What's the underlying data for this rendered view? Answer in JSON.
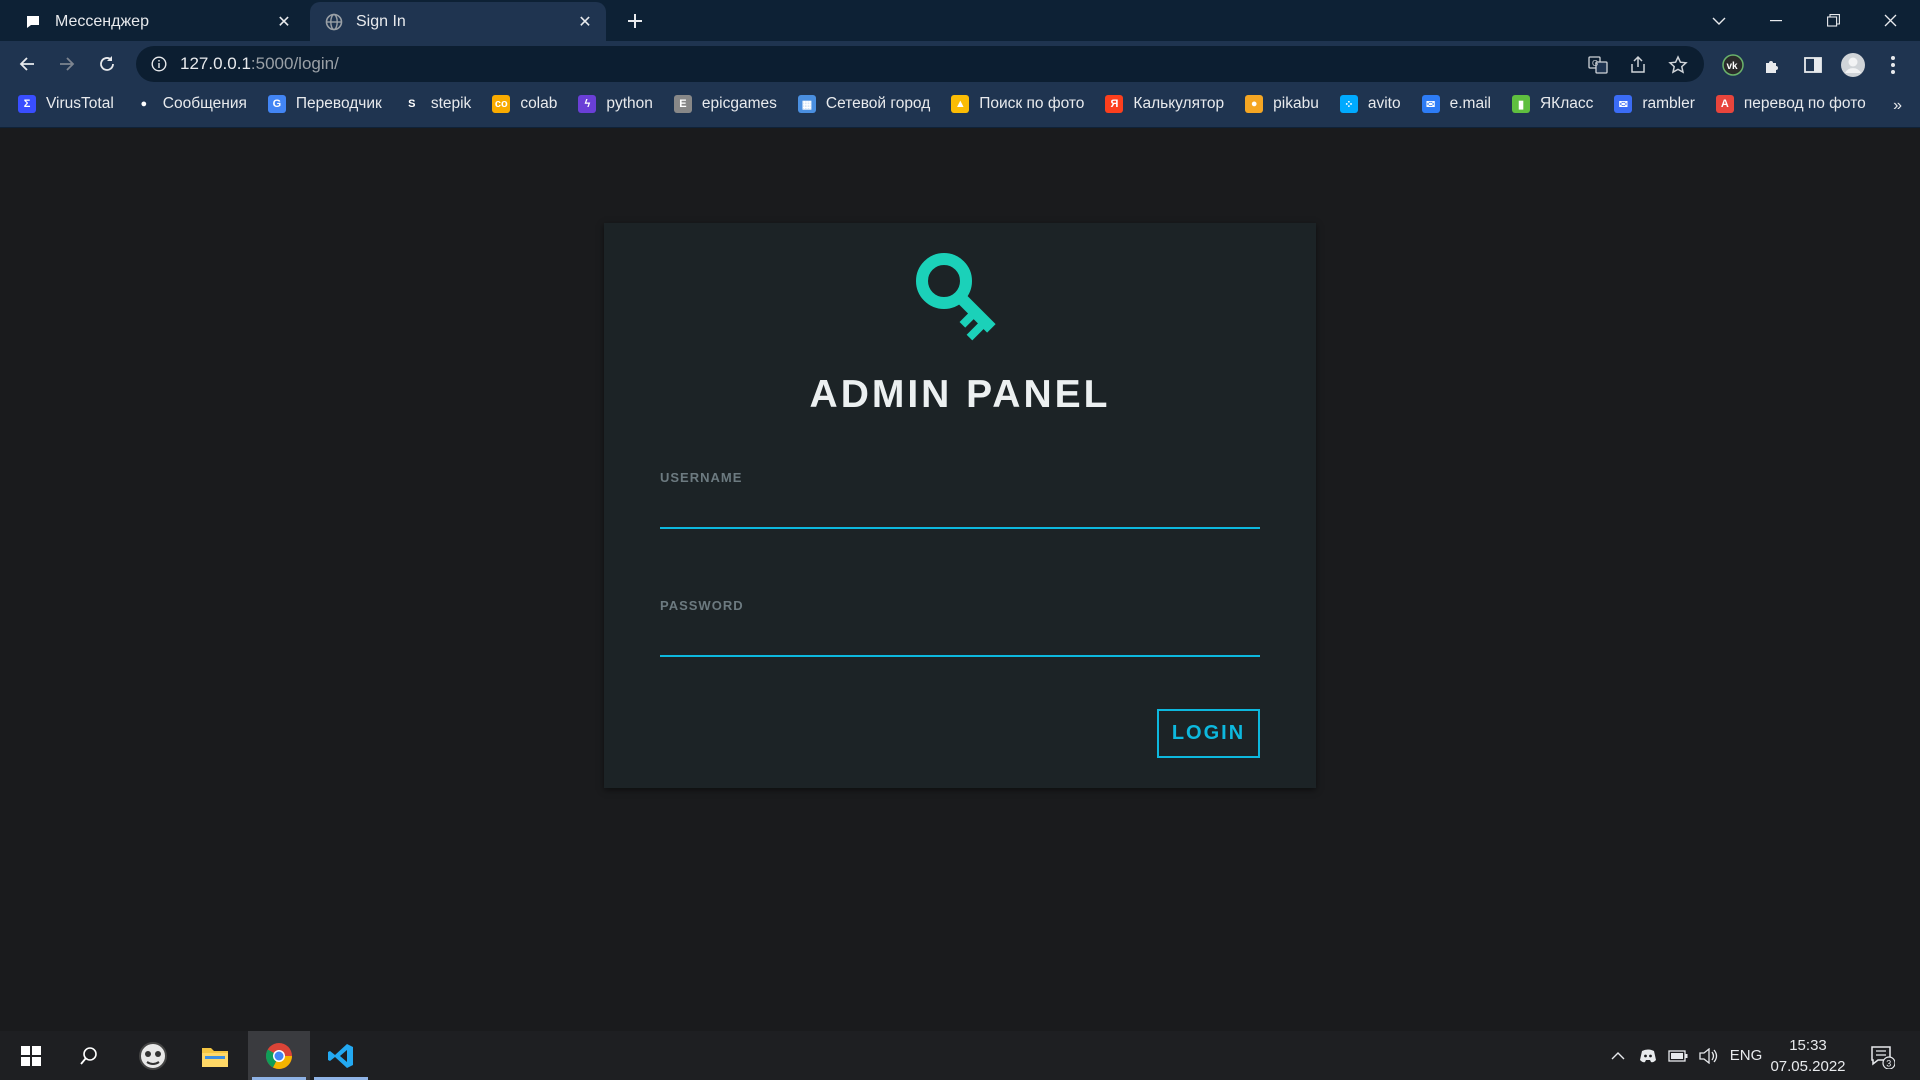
{
  "browser": {
    "tabs": [
      {
        "title": "Мессенджер",
        "active": false,
        "icon": "chat-bubble-icon"
      },
      {
        "title": "Sign In",
        "active": true,
        "icon": "globe-icon"
      }
    ],
    "url_host": "127.0.0.1",
    "url_rest": ":5000/login/",
    "bookmarks": [
      {
        "label": "VirusTotal",
        "icon": "virustotal-icon",
        "color": "#394eff"
      },
      {
        "label": "Сообщения",
        "icon": "chat-bubble-icon",
        "color": "#ffffff"
      },
      {
        "label": "Переводчик",
        "icon": "translate-icon",
        "color": "#4285f4"
      },
      {
        "label": "stepik",
        "icon": "stepik-icon",
        "color": "#ffffff"
      },
      {
        "label": "colab",
        "icon": "colab-icon",
        "color": "#f9ab00"
      },
      {
        "label": "python",
        "icon": "python-icon",
        "color": "#6a3fd6"
      },
      {
        "label": "epicgames",
        "icon": "epicgames-icon",
        "color": "#888888"
      },
      {
        "label": "Сетевой город",
        "icon": "city-icon",
        "color": "#4a8fe0"
      },
      {
        "label": "Поиск по фото",
        "icon": "photo-search-icon",
        "color": "#fbbc04"
      },
      {
        "label": "Калькулятор",
        "icon": "yandex-icon",
        "color": "#fc3f1d"
      },
      {
        "label": "pikabu",
        "icon": "pikabu-icon",
        "color": "#f5a623"
      },
      {
        "label": "avito",
        "icon": "avito-icon",
        "color": "#00aaff"
      },
      {
        "label": "e.mail",
        "icon": "mail-icon",
        "color": "#2d7cf6"
      },
      {
        "label": "ЯКласс",
        "icon": "yaklass-icon",
        "color": "#5fbf3f"
      },
      {
        "label": "rambler",
        "icon": "mail-icon",
        "color": "#3b6cf5"
      },
      {
        "label": "перевод по фото",
        "icon": "photo-translate-icon",
        "color": "#e8453c"
      }
    ],
    "bookmarks_more": "»"
  },
  "login": {
    "title": "ADMIN PANEL",
    "username_label": "USERNAME",
    "username_value": "",
    "password_label": "PASSWORD",
    "password_value": "",
    "button_label": "LOGIN",
    "accent_color": "#0db8de",
    "key_icon_color": "#1bd1b9"
  },
  "taskbar": {
    "language": "ENG",
    "time": "15:33",
    "date": "07.05.2022",
    "notifications": "3"
  }
}
